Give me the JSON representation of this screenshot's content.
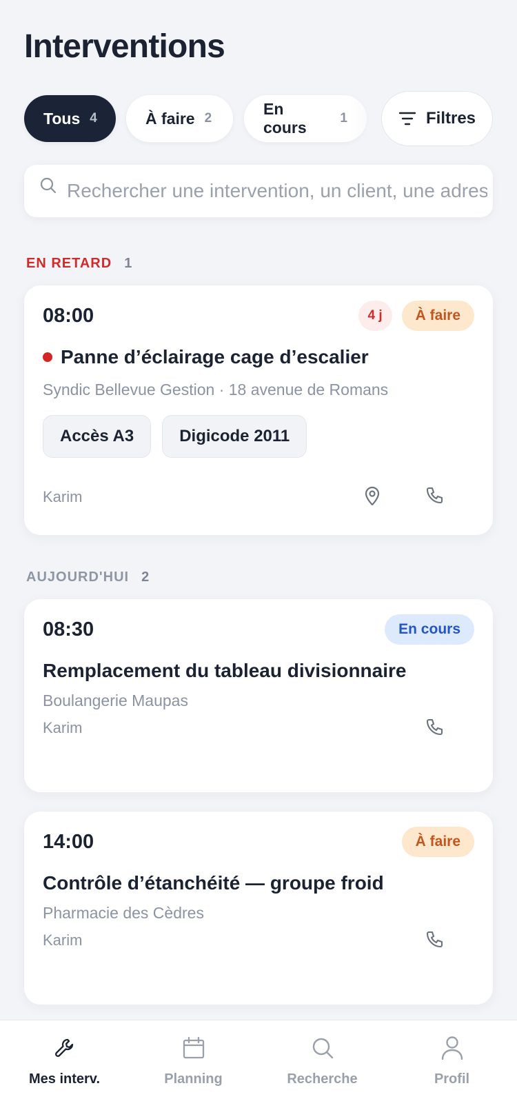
{
  "header": {
    "title": "Interventions"
  },
  "chips": [
    {
      "label": "Tous",
      "count": "4",
      "active": true
    },
    {
      "label": "À faire",
      "count": "2",
      "active": false
    },
    {
      "label": "En cours",
      "count": "1",
      "active": false
    }
  ],
  "filters": {
    "label": "Filtres",
    "icon": "filter-icon"
  },
  "search": {
    "placeholder": "Rechercher une intervention, un client, une adresse…",
    "value": ""
  },
  "sections": {
    "late": {
      "label": "EN RETARD",
      "count": "1",
      "color": "#cf2b2b"
    },
    "today": {
      "label": "AUJOURD'HUI",
      "count": "2"
    }
  },
  "cards": [
    {
      "time": "08:00",
      "late_badge": "4 j",
      "status": "À faire",
      "title": "Panne d’éclairage cage d’escalier",
      "client": "Syndic Bellevue Gestion · 18 avenue de Romans",
      "tags": [
        "Accès A3",
        "Digicode 2011"
      ],
      "technician": "Karim",
      "actions": [
        "map-pin-icon",
        "phone-icon"
      ]
    },
    {
      "time": "08:30",
      "status": "En cours",
      "title": "Remplacement du tableau divisionnaire",
      "client": "Boulangerie Maupas",
      "technician": "Karim",
      "actions": [
        "phone-icon"
      ]
    },
    {
      "time": "14:00",
      "status": "À faire",
      "title": "Contrôle d’étanchéité — groupe froid",
      "client": "Pharmacie des Cèdres",
      "technician": "Karim",
      "actions": [
        "phone-icon"
      ]
    }
  ],
  "nav": [
    {
      "label": "Mes interv.",
      "icon": "wrench-icon",
      "active": true
    },
    {
      "label": "Planning",
      "icon": "calendar-icon",
      "active": false
    },
    {
      "label": "Recherche",
      "icon": "search-icon",
      "active": false
    },
    {
      "label": "Profil",
      "icon": "user-icon",
      "active": false
    }
  ],
  "colors": {
    "active_chip": "#1b2437",
    "todo_badge_bg": "#fde7cd",
    "todo_badge_text": "#c2561d",
    "progress_badge_bg": "#dde9fc",
    "progress_badge_text": "#2355c6",
    "late_red": "#cf2b2b"
  }
}
